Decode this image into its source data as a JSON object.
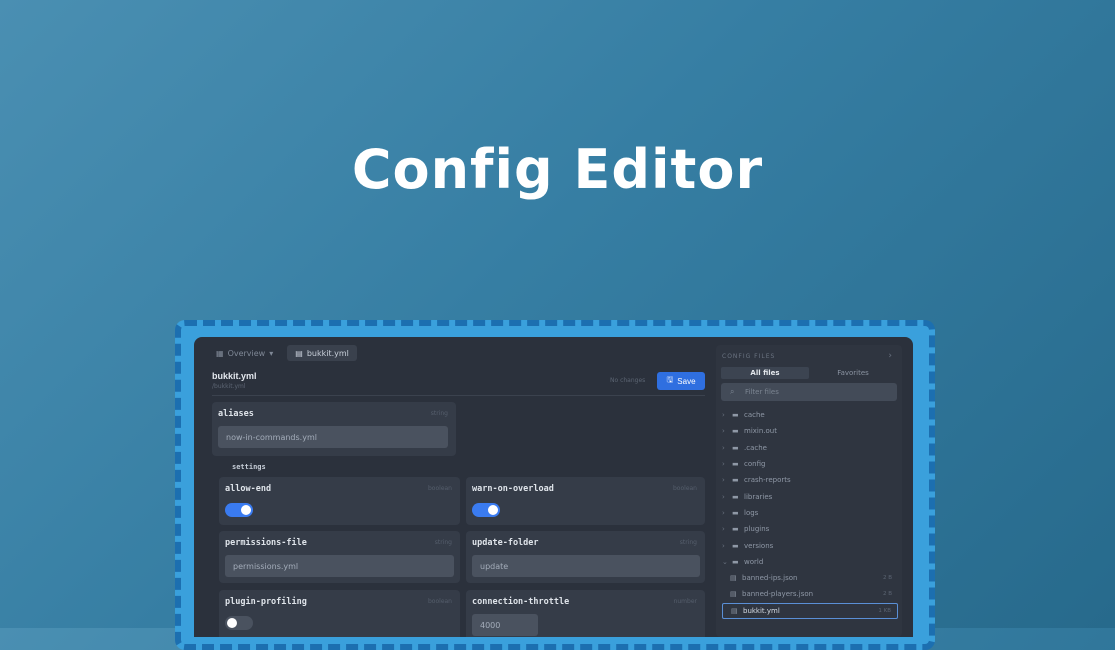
{
  "hero": {
    "title": "Config Editor"
  },
  "tabs": [
    {
      "label": "Overview",
      "icon": "grid-icon"
    },
    {
      "label": "bukkit.yml",
      "icon": "file-icon"
    }
  ],
  "editor": {
    "file_name": "bukkit.yml",
    "file_path": "/bukkit.yml",
    "status": "No changes",
    "save_label": "Save"
  },
  "fields": {
    "aliases": {
      "label": "aliases",
      "type": "string",
      "value": "now-in-commands.yml"
    },
    "settings_heading": "settings",
    "allow_end": {
      "label": "allow-end",
      "type": "boolean",
      "value": true
    },
    "warn_on_overload": {
      "label": "warn-on-overload",
      "type": "boolean",
      "value": true
    },
    "permissions_file": {
      "label": "permissions-file",
      "type": "string",
      "value": "permissions.yml"
    },
    "update_folder": {
      "label": "update-folder",
      "type": "string",
      "value": "update"
    },
    "plugin_profiling": {
      "label": "plugin-profiling",
      "type": "boolean",
      "value": false
    },
    "connection_throttle": {
      "label": "connection-throttle",
      "type": "number",
      "value": "4000"
    }
  },
  "sidebar": {
    "heading": "CONFIG FILES",
    "segments": [
      "All files",
      "Favorites"
    ],
    "search_placeholder": "Filter files",
    "items": [
      {
        "name": "cache",
        "kind": "folder"
      },
      {
        "name": "mixin.out",
        "kind": "folder"
      },
      {
        "name": ".cache",
        "kind": "folder"
      },
      {
        "name": "config",
        "kind": "folder"
      },
      {
        "name": "crash-reports",
        "kind": "folder"
      },
      {
        "name": "libraries",
        "kind": "folder"
      },
      {
        "name": "logs",
        "kind": "folder"
      },
      {
        "name": "plugins",
        "kind": "folder"
      },
      {
        "name": "versions",
        "kind": "folder"
      },
      {
        "name": "world",
        "kind": "folder"
      },
      {
        "name": "banned-ips.json",
        "kind": "file",
        "size": "2 B"
      },
      {
        "name": "banned-players.json",
        "kind": "file",
        "size": "2 B"
      },
      {
        "name": "bukkit.yml",
        "kind": "file",
        "size": "1 KB",
        "selected": true
      }
    ]
  }
}
